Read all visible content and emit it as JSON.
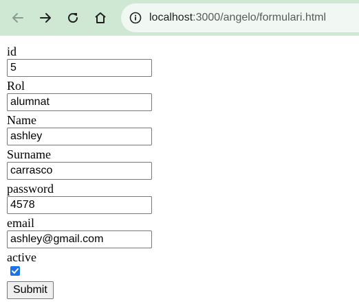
{
  "browser": {
    "url_host": "localhost",
    "url_rest": ":3000/angelo/formulari.html",
    "icons": {
      "back": "arrow-left-icon",
      "forward": "arrow-right-icon",
      "reload": "reload-icon",
      "home": "home-icon",
      "info": "info-icon"
    }
  },
  "form": {
    "fields": [
      {
        "label": "id",
        "value": "5"
      },
      {
        "label": "Rol",
        "value": "alumnat"
      },
      {
        "label": "Name",
        "value": "ashley"
      },
      {
        "label": "Surname",
        "value": "carrasco"
      },
      {
        "label": "password",
        "value": "4578"
      },
      {
        "label": "email",
        "value": "ashley@gmail.com"
      }
    ],
    "active_label": "active",
    "active_checked": true,
    "submit_label": "Submit"
  },
  "colors": {
    "toolbar": "#cfe8d4",
    "checkbox": "#1a73e8"
  }
}
